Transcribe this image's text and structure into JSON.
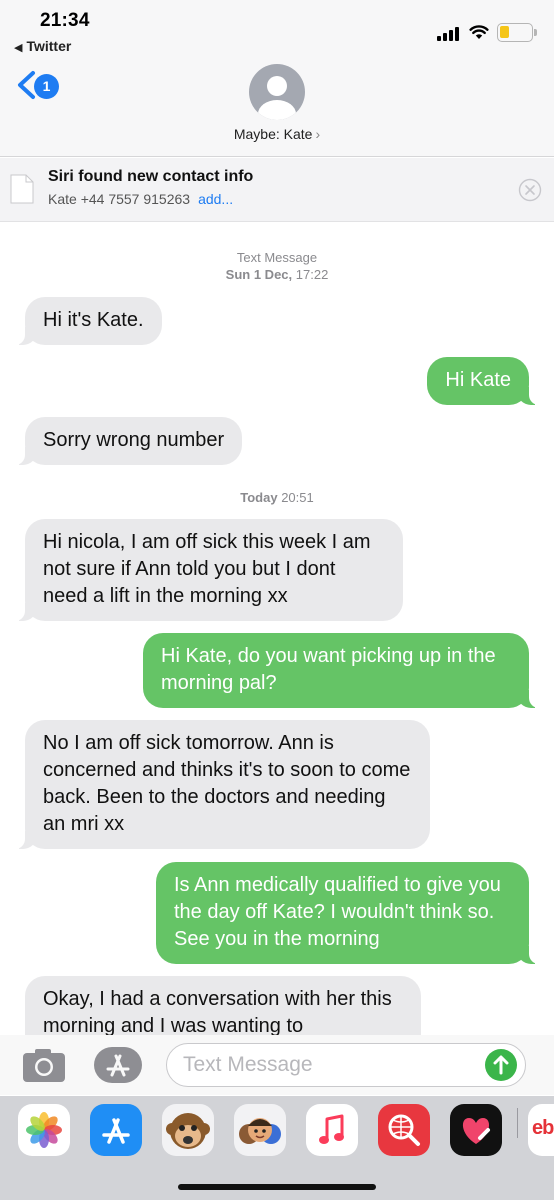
{
  "status_bar": {
    "time": "21:34",
    "back_app": "Twitter",
    "battery_color": "#f5c518"
  },
  "header": {
    "unread_count": "1",
    "contact_name": "Maybe: Kate",
    "chevron": "›",
    "icons": [
      "back-chevron-icon",
      "contact-avatar-icon"
    ]
  },
  "siri_banner": {
    "title": "Siri found new contact info",
    "contact_line": "Kate +44 7557 915263",
    "add_label": "add..."
  },
  "conversation": {
    "timestamp_1_label": "Text Message",
    "timestamp_1_day": "Sun 1 Dec,",
    "timestamp_1_time": "17:22",
    "timestamp_2_day": "Today",
    "timestamp_2_time": "20:51",
    "messages": [
      {
        "from": "them",
        "text": "Hi it's Kate."
      },
      {
        "from": "me",
        "text": "Hi Kate"
      },
      {
        "from": "them",
        "text": "Sorry wrong number"
      },
      {
        "from": "them",
        "text": "Hi nicola, I am off sick this week I am not sure if Ann told you but I dont need a lift in the morning xx"
      },
      {
        "from": "me",
        "text": "Hi Kate, do you want picking up in the morning pal?"
      },
      {
        "from": "them",
        "text": "No I am off sick tomorrow. Ann is concerned and thinks it's to soon to come back. Been to the doctors and needing an mri xx"
      },
      {
        "from": "me",
        "text": "Is Ann medically qualified to give you the day off Kate? I wouldn't think so. See you in the morning"
      },
      {
        "from": "them",
        "text": "Okay, I had a conversation with her this morning and I was wanting to"
      }
    ],
    "colors": {
      "incoming": "#e9e9eb",
      "outgoing": "#65c466"
    }
  },
  "input_bar": {
    "placeholder": "Text Message",
    "value": ""
  },
  "app_drawer": {
    "apps": [
      "photos-app-icon",
      "app-store-icon",
      "monkey-animoji-icon",
      "memoji-icon",
      "music-app-icon",
      "web-search-icon",
      "digital-touch-icon",
      "ebay-app-icon"
    ],
    "ebay_text": "eb"
  }
}
